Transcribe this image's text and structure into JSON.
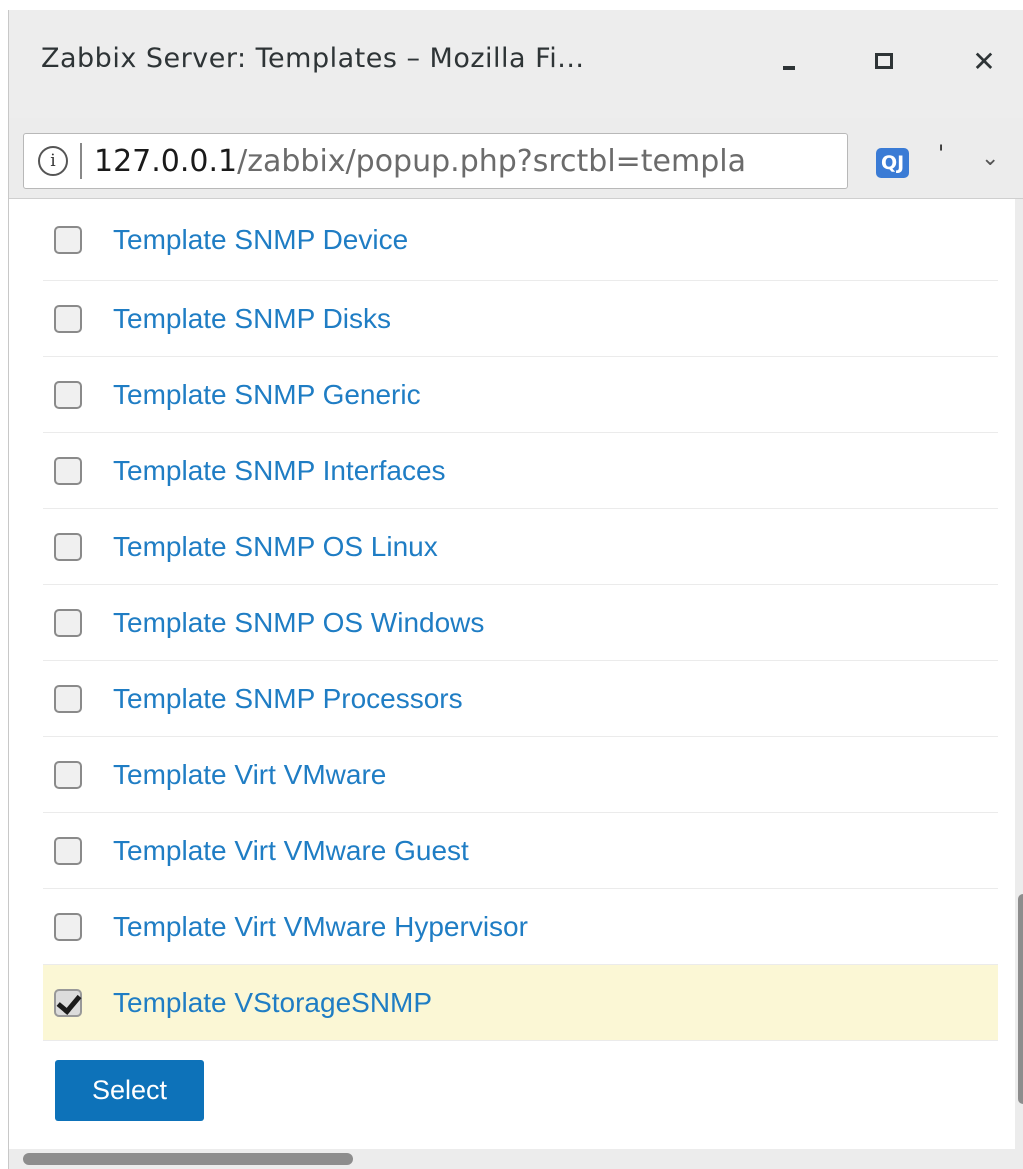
{
  "window": {
    "title": "Zabbix Server: Templates – Mozilla Fi...",
    "minimize_label": "_",
    "close_label": "✕"
  },
  "navbar": {
    "info_icon_glyph": "i",
    "url_host": "127.0.0.1",
    "url_path": "/zabbix/popup.php?srctbl=templa",
    "extension_badge": "QJ",
    "extension_mark": "'",
    "menu_glyph": "⌄"
  },
  "templates": [
    {
      "name": "Template SNMP Device",
      "checked": false
    },
    {
      "name": "Template SNMP Disks",
      "checked": false
    },
    {
      "name": "Template SNMP Generic",
      "checked": false
    },
    {
      "name": "Template SNMP Interfaces",
      "checked": false
    },
    {
      "name": "Template SNMP OS Linux",
      "checked": false
    },
    {
      "name": "Template SNMP OS Windows",
      "checked": false
    },
    {
      "name": "Template SNMP Processors",
      "checked": false
    },
    {
      "name": "Template Virt VMware",
      "checked": false
    },
    {
      "name": "Template Virt VMware Guest",
      "checked": false
    },
    {
      "name": "Template Virt VMware Hypervisor",
      "checked": false
    },
    {
      "name": "Template VStorageSNMP",
      "checked": true
    }
  ],
  "actions": {
    "select_label": "Select"
  },
  "colors": {
    "link": "#1f7dc4",
    "button": "#0d72b9",
    "checked_row": "#fbf7d5"
  }
}
